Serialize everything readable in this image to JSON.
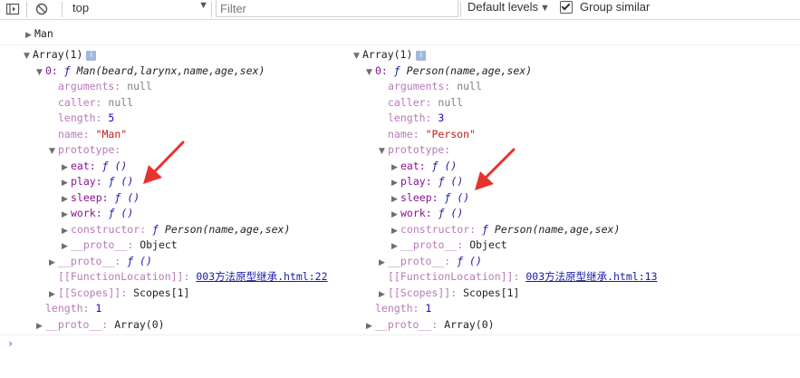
{
  "toolbar": {
    "context": "top",
    "filter_placeholder": "Filter",
    "levels": "Default levels",
    "group_label": "Group similar",
    "group_checked": true
  },
  "console": {
    "collapsed_entry": "Man",
    "left": {
      "header": "Array(1)",
      "info": "i",
      "item_key": "0:",
      "item_f": "ƒ",
      "item_sig": "Man(beard,larynx,name,age,sex)",
      "arguments": {
        "key": "arguments:",
        "val": "null"
      },
      "caller": {
        "key": "caller:",
        "val": "null"
      },
      "length": {
        "key": "length:",
        "val": "5"
      },
      "name": {
        "key": "name:",
        "val": "\"Man\""
      },
      "prototype_key": "prototype:",
      "methods": [
        {
          "key": "eat:",
          "val": "ƒ ()"
        },
        {
          "key": "play:",
          "val": "ƒ ()"
        },
        {
          "key": "sleep:",
          "val": "ƒ ()"
        },
        {
          "key": "work:",
          "val": "ƒ ()"
        }
      ],
      "constructor": {
        "key": "constructor:",
        "f": "ƒ",
        "val": "Person(name,age,sex)"
      },
      "proto_inner": {
        "key": "__proto__:",
        "val": "Object"
      },
      "proto_fn": {
        "key": "__proto__:",
        "val": "ƒ ()"
      },
      "location": {
        "key": "[[FunctionLocation]]:",
        "val": "003方法原型继承.html:22"
      },
      "scopes": {
        "key": "[[Scopes]]:",
        "val": "Scopes[1]"
      },
      "arr_length": {
        "key": "length:",
        "val": "1"
      },
      "arr_proto": {
        "key": "__proto__:",
        "val": "Array(0)"
      }
    },
    "right": {
      "header": "Array(1)",
      "info": "i",
      "item_key": "0:",
      "item_f": "ƒ",
      "item_sig": "Person(name,age,sex)",
      "arguments": {
        "key": "arguments:",
        "val": "null"
      },
      "caller": {
        "key": "caller:",
        "val": "null"
      },
      "length": {
        "key": "length:",
        "val": "3"
      },
      "name": {
        "key": "name:",
        "val": "\"Person\""
      },
      "prototype_key": "prototype:",
      "methods": [
        {
          "key": "eat:",
          "val": "ƒ ()"
        },
        {
          "key": "play:",
          "val": "ƒ ()"
        },
        {
          "key": "sleep:",
          "val": "ƒ ()"
        },
        {
          "key": "work:",
          "val": "ƒ ()"
        }
      ],
      "constructor": {
        "key": "constructor:",
        "f": "ƒ",
        "val": "Person(name,age,sex)"
      },
      "proto_inner": {
        "key": "__proto__:",
        "val": "Object"
      },
      "proto_fn": {
        "key": "__proto__:",
        "val": "ƒ ()"
      },
      "location": {
        "key": "[[FunctionLocation]]:",
        "val": "003方法原型继承.html:13"
      },
      "scopes": {
        "key": "[[Scopes]]:",
        "val": "Scopes[1]"
      },
      "arr_length": {
        "key": "length:",
        "val": "1"
      },
      "arr_proto": {
        "key": "__proto__:",
        "val": "Array(0)"
      }
    },
    "prompt": "›",
    "annotation_color": "#e8322e"
  }
}
